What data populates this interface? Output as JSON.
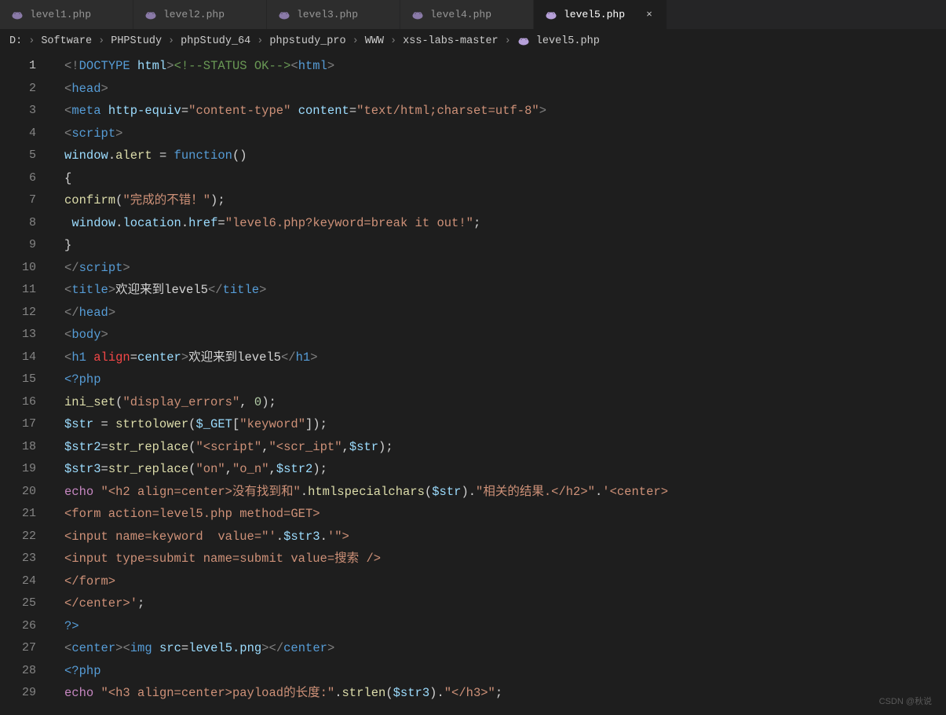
{
  "tabs": [
    {
      "label": "level1.php",
      "active": false,
      "icon": "elephant-icon"
    },
    {
      "label": "level2.php",
      "active": false,
      "icon": "elephant-icon"
    },
    {
      "label": "level3.php",
      "active": false,
      "icon": "elephant-icon"
    },
    {
      "label": "level4.php",
      "active": false,
      "icon": "elephant-icon"
    },
    {
      "label": "level5.php",
      "active": true,
      "icon": "elephant-icon"
    }
  ],
  "breadcrumb": {
    "items": [
      "D:",
      "Software",
      "PHPStudy",
      "phpStudy_64",
      "phpstudy_pro",
      "WWW",
      "xss-labs-master",
      "level5.php"
    ],
    "sep": "›",
    "file_icon": "elephant-icon"
  },
  "line_numbers": [
    "1",
    "2",
    "3",
    "4",
    "5",
    "6",
    "7",
    "8",
    "9",
    "10",
    "11",
    "12",
    "13",
    "14",
    "15",
    "16",
    "17",
    "18",
    "19",
    "20",
    "21",
    "22",
    "23",
    "24",
    "25",
    "26",
    "27",
    "28",
    "29"
  ],
  "active_line": 1,
  "watermark": "CSDN @秋说",
  "code_lines": [
    [
      {
        "c": "pun",
        "t": "<!"
      },
      {
        "c": "htmlkw",
        "t": "DOCTYPE "
      },
      {
        "c": "attrname",
        "t": "html"
      },
      {
        "c": "pun",
        "t": ">"
      },
      {
        "c": "com",
        "t": "<!--STATUS OK-->"
      },
      {
        "c": "pun",
        "t": "<"
      },
      {
        "c": "tagname",
        "t": "html"
      },
      {
        "c": "pun",
        "t": ">"
      }
    ],
    [
      {
        "c": "pun",
        "t": "<"
      },
      {
        "c": "tagname",
        "t": "head"
      },
      {
        "c": "pun",
        "t": ">"
      }
    ],
    [
      {
        "c": "pun",
        "t": "<"
      },
      {
        "c": "tagname",
        "t": "meta "
      },
      {
        "c": "attrname",
        "t": "http-equiv"
      },
      {
        "c": "tx",
        "t": "="
      },
      {
        "c": "str",
        "t": "\"content-type\""
      },
      {
        "c": "tx",
        "t": " "
      },
      {
        "c": "attrname",
        "t": "content"
      },
      {
        "c": "tx",
        "t": "="
      },
      {
        "c": "str",
        "t": "\"text/html;charset=utf-8\""
      },
      {
        "c": "pun",
        "t": ">"
      }
    ],
    [
      {
        "c": "pun",
        "t": "<"
      },
      {
        "c": "tagname",
        "t": "script"
      },
      {
        "c": "pun",
        "t": ">"
      }
    ],
    [
      {
        "c": "var",
        "t": "window"
      },
      {
        "c": "tx",
        "t": "."
      },
      {
        "c": "fn",
        "t": "alert"
      },
      {
        "c": "tx",
        "t": " = "
      },
      {
        "c": "kw",
        "t": "function"
      },
      {
        "c": "tx",
        "t": "()"
      }
    ],
    [
      {
        "c": "tx",
        "t": "{"
      }
    ],
    [
      {
        "c": "fn",
        "t": "confirm"
      },
      {
        "c": "tx",
        "t": "("
      },
      {
        "c": "str",
        "t": "\"完成的不错！\""
      },
      {
        "c": "tx",
        "t": ");"
      }
    ],
    [
      {
        "c": "tx",
        "t": " "
      },
      {
        "c": "var",
        "t": "window"
      },
      {
        "c": "tx",
        "t": "."
      },
      {
        "c": "var",
        "t": "location"
      },
      {
        "c": "tx",
        "t": "."
      },
      {
        "c": "var",
        "t": "href"
      },
      {
        "c": "tx",
        "t": "="
      },
      {
        "c": "str",
        "t": "\"level6.php?keyword=break it out!\""
      },
      {
        "c": "tx",
        "t": ";"
      }
    ],
    [
      {
        "c": "tx",
        "t": "}"
      }
    ],
    [
      {
        "c": "pun",
        "t": "</"
      },
      {
        "c": "tagname",
        "t": "script"
      },
      {
        "c": "pun",
        "t": ">"
      }
    ],
    [
      {
        "c": "pun",
        "t": "<"
      },
      {
        "c": "tagname",
        "t": "title"
      },
      {
        "c": "pun",
        "t": ">"
      },
      {
        "c": "tx",
        "t": "欢迎来到level5"
      },
      {
        "c": "pun",
        "t": "</"
      },
      {
        "c": "tagname",
        "t": "title"
      },
      {
        "c": "pun",
        "t": ">"
      }
    ],
    [
      {
        "c": "pun",
        "t": "</"
      },
      {
        "c": "tagname",
        "t": "head"
      },
      {
        "c": "pun",
        "t": ">"
      }
    ],
    [
      {
        "c": "pun",
        "t": "<"
      },
      {
        "c": "tagname",
        "t": "body"
      },
      {
        "c": "pun",
        "t": ">"
      }
    ],
    [
      {
        "c": "pun",
        "t": "<"
      },
      {
        "c": "tagname",
        "t": "h1 "
      },
      {
        "c": "r",
        "t": "align"
      },
      {
        "c": "tx",
        "t": "="
      },
      {
        "c": "attrname",
        "t": "center"
      },
      {
        "c": "pun",
        "t": ">"
      },
      {
        "c": "tx",
        "t": "欢迎来到level5"
      },
      {
        "c": "pun",
        "t": "</"
      },
      {
        "c": "tagname",
        "t": "h1"
      },
      {
        "c": "pun",
        "t": ">"
      }
    ],
    [
      {
        "c": "tagname",
        "t": "<?php"
      }
    ],
    [
      {
        "c": "fn",
        "t": "ini_set"
      },
      {
        "c": "tx",
        "t": "("
      },
      {
        "c": "str",
        "t": "\"display_errors\""
      },
      {
        "c": "tx",
        "t": ", "
      },
      {
        "c": "num",
        "t": "0"
      },
      {
        "c": "tx",
        "t": ");"
      }
    ],
    [
      {
        "c": "var",
        "t": "$str"
      },
      {
        "c": "tx",
        "t": " = "
      },
      {
        "c": "fn",
        "t": "strtolower"
      },
      {
        "c": "tx",
        "t": "("
      },
      {
        "c": "var",
        "t": "$_GET"
      },
      {
        "c": "tx",
        "t": "["
      },
      {
        "c": "str",
        "t": "\"keyword\""
      },
      {
        "c": "tx",
        "t": "]);"
      }
    ],
    [
      {
        "c": "var",
        "t": "$str2"
      },
      {
        "c": "tx",
        "t": "="
      },
      {
        "c": "fn",
        "t": "str_replace"
      },
      {
        "c": "tx",
        "t": "("
      },
      {
        "c": "str",
        "t": "\"<script\""
      },
      {
        "c": "tx",
        "t": ","
      },
      {
        "c": "str",
        "t": "\"<scr_ipt\""
      },
      {
        "c": "tx",
        "t": ","
      },
      {
        "c": "var",
        "t": "$str"
      },
      {
        "c": "tx",
        "t": ");"
      }
    ],
    [
      {
        "c": "var",
        "t": "$str3"
      },
      {
        "c": "tx",
        "t": "="
      },
      {
        "c": "fn",
        "t": "str_replace"
      },
      {
        "c": "tx",
        "t": "("
      },
      {
        "c": "str",
        "t": "\"on\""
      },
      {
        "c": "tx",
        "t": ","
      },
      {
        "c": "str",
        "t": "\"o_n\""
      },
      {
        "c": "tx",
        "t": ","
      },
      {
        "c": "var",
        "t": "$str2"
      },
      {
        "c": "tx",
        "t": ");"
      }
    ],
    [
      {
        "c": "kw2",
        "t": "echo"
      },
      {
        "c": "tx",
        "t": " "
      },
      {
        "c": "str",
        "t": "\"<h2 align=center>没有找到和\""
      },
      {
        "c": "tx",
        "t": "."
      },
      {
        "c": "fn",
        "t": "htmlspecialchars"
      },
      {
        "c": "tx",
        "t": "("
      },
      {
        "c": "var",
        "t": "$str"
      },
      {
        "c": "tx",
        "t": ")."
      },
      {
        "c": "str",
        "t": "\"相关的结果.</h2>\""
      },
      {
        "c": "tx",
        "t": "."
      },
      {
        "c": "str",
        "t": "'<center>"
      }
    ],
    [
      {
        "c": "str",
        "t": "<form action=level5.php method=GET>"
      }
    ],
    [
      {
        "c": "str",
        "t": "<input name=keyword  value=\"'"
      },
      {
        "c": "tx",
        "t": "."
      },
      {
        "c": "var",
        "t": "$str3"
      },
      {
        "c": "tx",
        "t": "."
      },
      {
        "c": "str",
        "t": "'\">"
      }
    ],
    [
      {
        "c": "str",
        "t": "<input type=submit name=submit value=搜索 />"
      }
    ],
    [
      {
        "c": "str",
        "t": "</form>"
      }
    ],
    [
      {
        "c": "str",
        "t": "</center>'"
      },
      {
        "c": "tx",
        "t": ";"
      }
    ],
    [
      {
        "c": "tagname",
        "t": "?>"
      }
    ],
    [
      {
        "c": "pun",
        "t": "<"
      },
      {
        "c": "tagname",
        "t": "center"
      },
      {
        "c": "pun",
        "t": ">"
      },
      {
        "c": "pun",
        "t": "<"
      },
      {
        "c": "tagname",
        "t": "img "
      },
      {
        "c": "attrname",
        "t": "src"
      },
      {
        "c": "tx",
        "t": "="
      },
      {
        "c": "attrname",
        "t": "level5.png"
      },
      {
        "c": "pun",
        "t": ">"
      },
      {
        "c": "pun",
        "t": "</"
      },
      {
        "c": "tagname",
        "t": "center"
      },
      {
        "c": "pun",
        "t": ">"
      }
    ],
    [
      {
        "c": "tagname",
        "t": "<?php"
      }
    ],
    [
      {
        "c": "kw2",
        "t": "echo"
      },
      {
        "c": "tx",
        "t": " "
      },
      {
        "c": "str",
        "t": "\"<h3 align=center>payload的长度:\""
      },
      {
        "c": "tx",
        "t": "."
      },
      {
        "c": "fn",
        "t": "strlen"
      },
      {
        "c": "tx",
        "t": "("
      },
      {
        "c": "var",
        "t": "$str3"
      },
      {
        "c": "tx",
        "t": ")."
      },
      {
        "c": "str",
        "t": "\"</h3>\""
      },
      {
        "c": "tx",
        "t": ";"
      }
    ]
  ]
}
